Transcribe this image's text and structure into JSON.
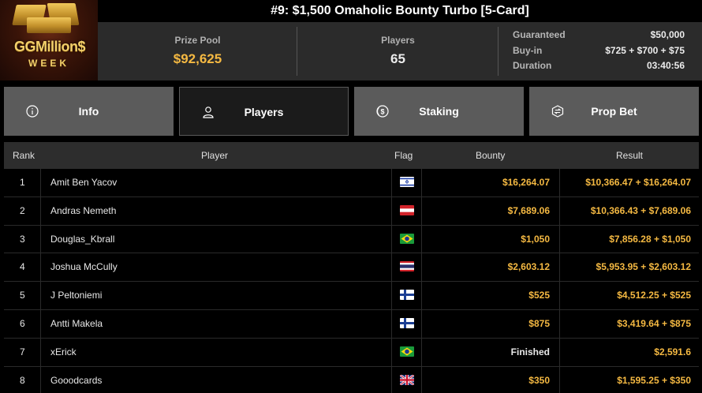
{
  "logo": {
    "brand": "GGMillion$",
    "sub": "WEEK"
  },
  "title": "#9: $1,500 Omaholic Bounty Turbo [5-Card]",
  "stats": {
    "prize_pool_label": "Prize Pool",
    "prize_pool_value": "$92,625",
    "players_label": "Players",
    "players_value": "65"
  },
  "details": [
    {
      "key": "Guaranteed",
      "value": "$50,000"
    },
    {
      "key": "Buy-in",
      "value": "$725 + $700 + $75"
    },
    {
      "key": "Duration",
      "value": "03:40:56"
    }
  ],
  "tabs": [
    {
      "label": "Info",
      "icon": "info-icon"
    },
    {
      "label": "Players",
      "icon": "user-icon",
      "active": true
    },
    {
      "label": "Staking",
      "icon": "dollar-coin-icon"
    },
    {
      "label": "Prop Bet",
      "icon": "prop-bet-icon"
    }
  ],
  "table": {
    "headers": {
      "rank": "Rank",
      "player": "Player",
      "flag": "Flag",
      "bounty": "Bounty",
      "result": "Result"
    },
    "rows": [
      {
        "rank": "1",
        "player": "Amit Ben Yacov",
        "flag": "israel-flag-icon",
        "bounty": "$16,264.07",
        "result": "$10,366.47 + $16,264.07"
      },
      {
        "rank": "2",
        "player": "Andras Nemeth",
        "flag": "austria-flag-icon",
        "bounty": "$7,689.06",
        "result": "$10,366.43 + $7,689.06"
      },
      {
        "rank": "3",
        "player": "Douglas_Kbrall",
        "flag": "brazil-flag-icon",
        "bounty": "$1,050",
        "result": "$7,856.28 + $1,050"
      },
      {
        "rank": "4",
        "player": "Joshua McCully",
        "flag": "thailand-flag-icon",
        "bounty": "$2,603.12",
        "result": "$5,953.95 + $2,603.12"
      },
      {
        "rank": "5",
        "player": "J Peltoniemi",
        "flag": "finland-flag-icon",
        "bounty": "$525",
        "result": "$4,512.25 + $525"
      },
      {
        "rank": "6",
        "player": "Antti Makela",
        "flag": "finland-flag-icon",
        "bounty": "$875",
        "result": "$3,419.64 + $875"
      },
      {
        "rank": "7",
        "player": "xErick",
        "flag": "brazil-flag-icon",
        "bounty": "Finished",
        "result": "$2,591.6"
      },
      {
        "rank": "8",
        "player": "Gooodcards",
        "flag": "uk-flag-icon",
        "bounty": "$350",
        "result": "$1,595.25 + $350"
      }
    ]
  },
  "colors": {
    "accent": "#f5b942",
    "tab_bg": "#5b5b5b",
    "panel_bg": "#2b2b2b"
  }
}
